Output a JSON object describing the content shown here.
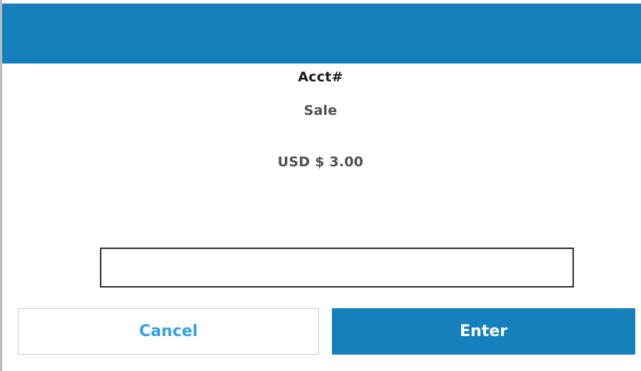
{
  "header": {
    "color": "#1481bc"
  },
  "prompt": {
    "title": "Acct#",
    "transaction_type": "Sale",
    "amount": "USD $ 3.00"
  },
  "input": {
    "value": "",
    "placeholder": ""
  },
  "buttons": {
    "cancel_label": "Cancel",
    "enter_label": "Enter"
  },
  "colors": {
    "accent": "#1481bc",
    "cancel_text": "#2ea3e0"
  }
}
